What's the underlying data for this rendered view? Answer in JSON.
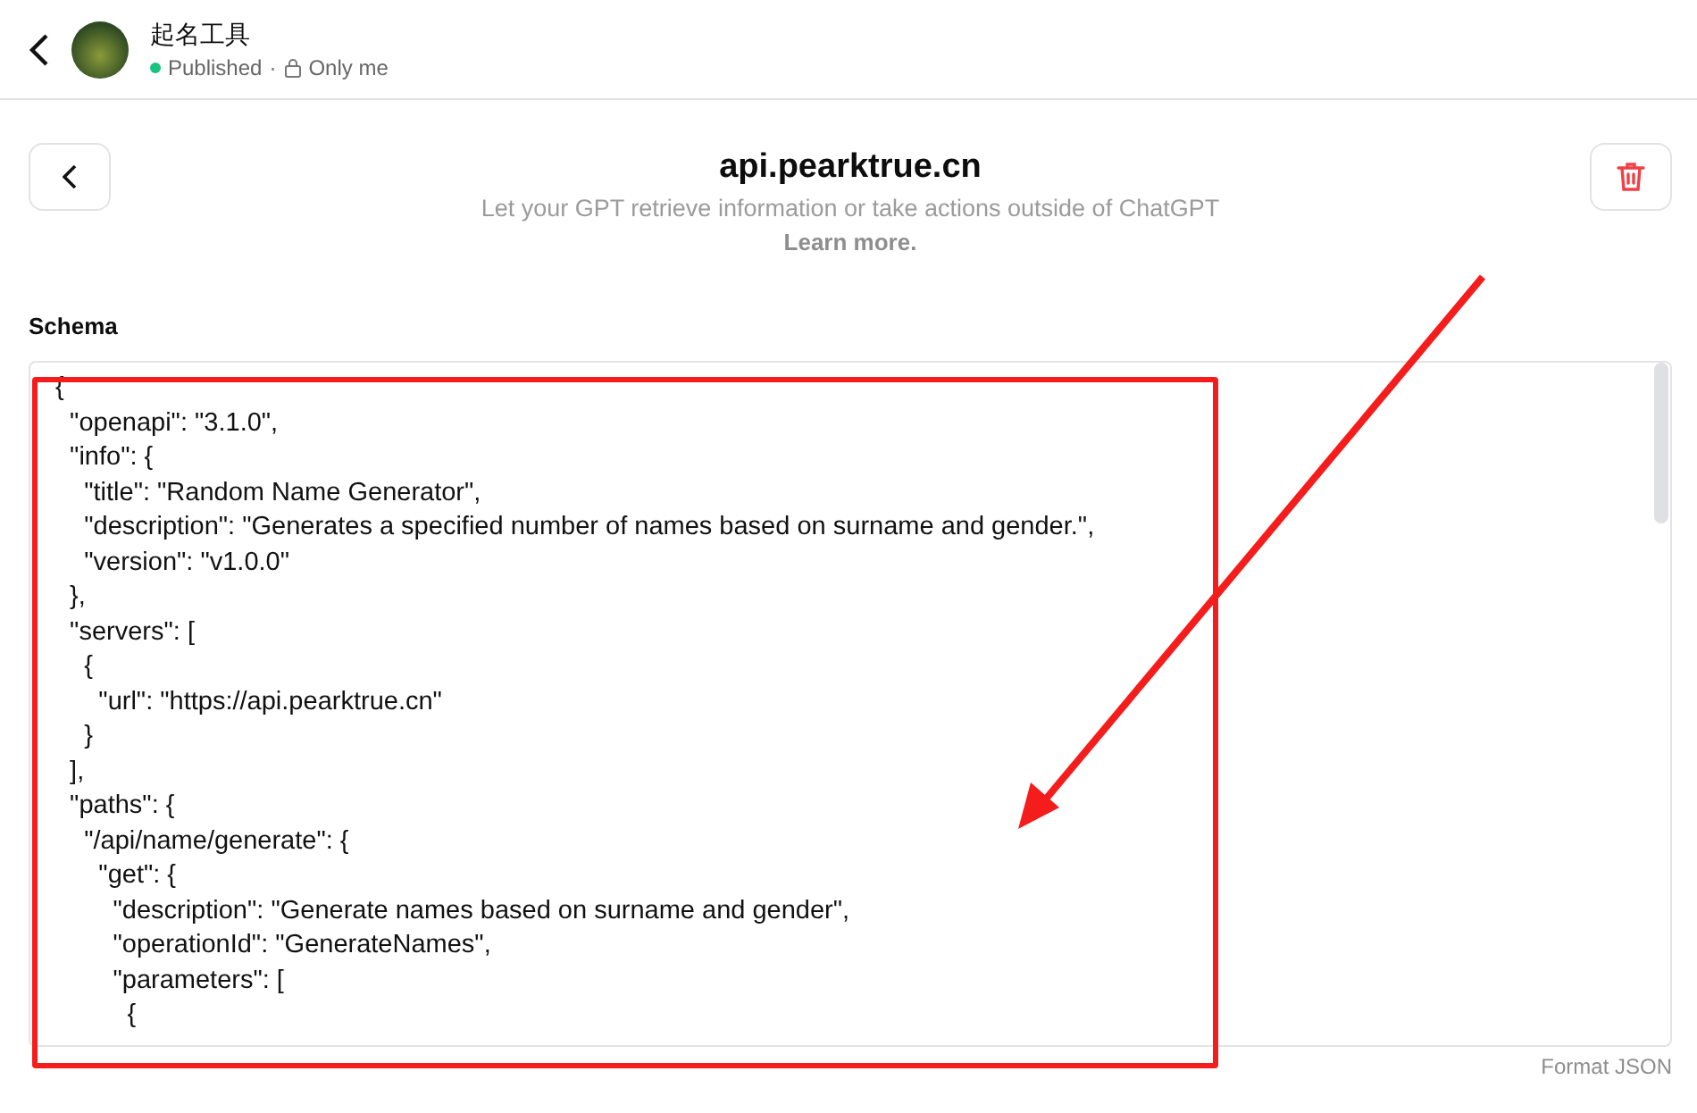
{
  "header": {
    "gpt_name": "起名工具",
    "status": "Published",
    "status_on": true,
    "separator": "·",
    "visibility": "Only me"
  },
  "action": {
    "title": "api.pearktrue.cn",
    "subtitle": "Let your GPT retrieve information or take actions outside of ChatGPT",
    "learn_more": "Learn more."
  },
  "schema": {
    "label": "Schema",
    "lines": [
      "{",
      "  \"openapi\": \"3.1.0\",",
      "  \"info\": {",
      "    \"title\": \"Random Name Generator\",",
      "    \"description\": \"Generates a specified number of names based on surname and gender.\",",
      "    \"version\": \"v1.0.0\"",
      "  },",
      "  \"servers\": [",
      "    {",
      "      \"url\": \"https://api.pearktrue.cn\"",
      "    }",
      "  ],",
      "  \"paths\": {",
      "    \"/api/name/generate\": {",
      "      \"get\": {",
      "        \"description\": \"Generate names based on surname and gender\",",
      "        \"operationId\": \"GenerateNames\",",
      "        \"parameters\": [",
      "          {"
    ],
    "format_button": "Format JSON"
  }
}
